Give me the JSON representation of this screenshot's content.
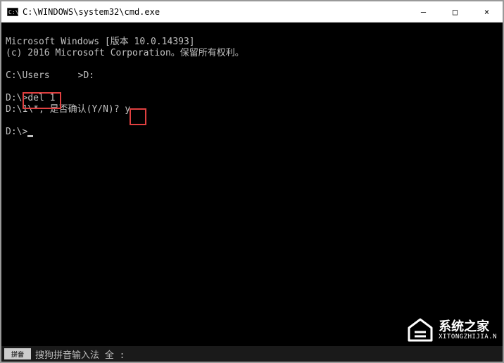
{
  "titlebar": {
    "title": "C:\\WINDOWS\\system32\\cmd.exe",
    "minimize": "—",
    "maximize": "□",
    "close": "×"
  },
  "terminal": {
    "line1": "Microsoft Windows [版本 10.0.14393]",
    "line2": "(c) 2016 Microsoft Corporation。保留所有权利。",
    "line3_prefix": "C:\\Users",
    "line3_suffix": ">D:",
    "line4_prompt": "D:\\>",
    "line4_cmd": "del 1",
    "line5_prefix": "D:\\1\\*, 是否确认(Y/N)? ",
    "line5_answer": "y",
    "line6_prompt": "D:\\>"
  },
  "ime": {
    "text": "搜狗拼音输入法 全 :"
  },
  "watermark": {
    "main": "系统之家",
    "sub": "XITONGZHIJIA.N"
  },
  "highlights": {
    "box1": "del 1",
    "box2": "y"
  }
}
